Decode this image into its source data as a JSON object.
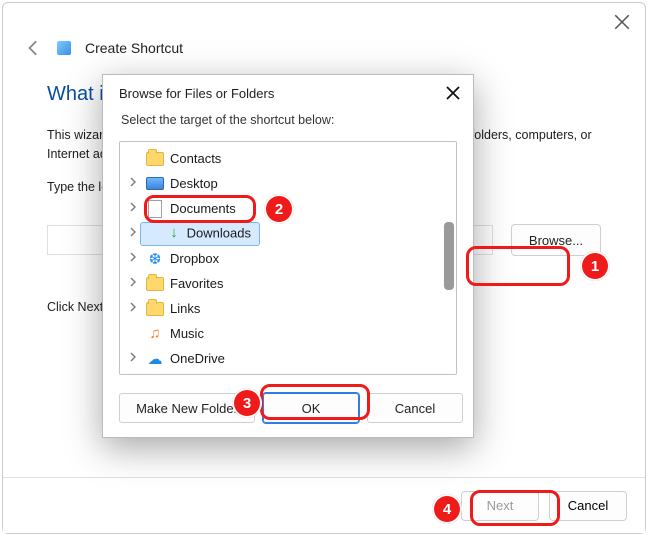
{
  "wizard": {
    "title": "Create Shortcut",
    "heading": "What item would you like to create a shortcut for?",
    "heading_truncated": "What ite",
    "description": "This wizard helps you to create shortcuts to local or network programs, files, folders, computers, or Internet addresses.",
    "location_label": "Type the location of the item:",
    "location_label_truncated": "Type the lo",
    "browse_label": "Browse...",
    "click_next": "Click Next to continue.",
    "click_next_truncated": "Click Next",
    "next_label": "Next",
    "cancel_label": "Cancel"
  },
  "dialog": {
    "title": "Browse for Files or Folders",
    "subtitle": "Select the target of the shortcut below:",
    "make_new_folder_label": "Make New Folder",
    "ok_label": "OK",
    "cancel_label": "Cancel",
    "selected": "Downloads",
    "tree": [
      {
        "label": "Contacts",
        "icon": "folder",
        "expandable": false
      },
      {
        "label": "Desktop",
        "icon": "desktop",
        "expandable": true
      },
      {
        "label": "Documents",
        "icon": "docs",
        "expandable": true
      },
      {
        "label": "Downloads",
        "icon": "download",
        "expandable": true,
        "selected": true
      },
      {
        "label": "Dropbox",
        "icon": "dropbox",
        "expandable": true
      },
      {
        "label": "Favorites",
        "icon": "folder",
        "expandable": true
      },
      {
        "label": "Links",
        "icon": "folder",
        "expandable": true
      },
      {
        "label": "Music",
        "icon": "music",
        "expandable": false
      },
      {
        "label": "OneDrive",
        "icon": "onedrive",
        "expandable": true
      }
    ]
  },
  "callouts": {
    "b1": "1",
    "b2": "2",
    "b3": "3",
    "b4": "4"
  }
}
